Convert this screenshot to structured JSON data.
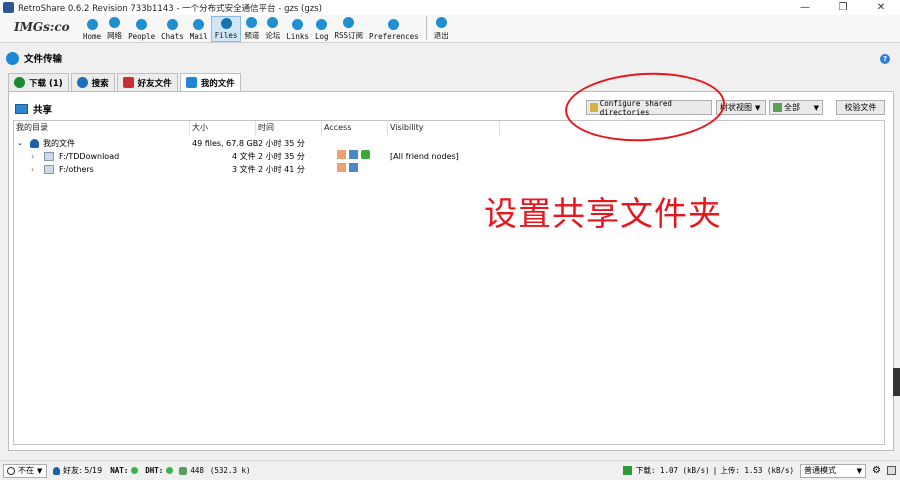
{
  "window": {
    "title": "RetroShare 0.6.2 Revision 733b1143 - 一个分布式安全通信平台 - gzs (gzs)",
    "controls": [
      "—",
      "❐",
      "✕"
    ]
  },
  "toolbar": {
    "logo": "IMGs:co",
    "items": [
      {
        "label": "Home",
        "icon": "home-icon"
      },
      {
        "label": "网络",
        "icon": "network-icon"
      },
      {
        "label": "People",
        "icon": "people-icon"
      },
      {
        "label": "Chats",
        "icon": "chats-icon"
      },
      {
        "label": "Mail",
        "icon": "mail-icon"
      },
      {
        "label": "Files",
        "icon": "files-icon",
        "active": true
      },
      {
        "label": "频道",
        "icon": "channels-icon"
      },
      {
        "label": "论坛",
        "icon": "forums-icon"
      },
      {
        "label": "Links",
        "icon": "links-icon"
      },
      {
        "label": "Log",
        "icon": "log-icon"
      },
      {
        "label": "RSS订阅",
        "icon": "rss-icon"
      },
      {
        "label": "Preferences",
        "icon": "gear-icon"
      }
    ],
    "exit_label": "退出"
  },
  "section": {
    "title": "文件传输",
    "help": "?"
  },
  "tabs": [
    {
      "label": "下载 (1)",
      "icon": "download-icon",
      "color": "#1b8a2e"
    },
    {
      "label": "搜索",
      "icon": "search-icon",
      "color": "#1e6fc2"
    },
    {
      "label": "好友文件",
      "icon": "friends-files-icon",
      "color": "#c83030"
    },
    {
      "label": "我的文件",
      "icon": "my-files-icon",
      "color": "#1e88d6",
      "active": true
    }
  ],
  "share": {
    "title": "共享",
    "configure_label": "Configure shared directories",
    "view_label": "树状视图",
    "filter_label": "全部",
    "check_label": "校验文件"
  },
  "columns": [
    "我的目录",
    "大小",
    "时间",
    "Access",
    "Visibility"
  ],
  "rows": [
    {
      "name": "我的文件",
      "size": "49 files, 67.8 GB",
      "time": "2 小时 35 分",
      "visibility": ""
    },
    {
      "name": "F:/TDDownload",
      "size": "4 文件",
      "time": "2 小时 35 分",
      "visibility": "[All friend nodes]"
    },
    {
      "name": "F:/others",
      "size": "3 文件",
      "time": "2 小时 41 分",
      "visibility": ""
    }
  ],
  "annotation": "设置共享文件夹",
  "status": {
    "state": "不在",
    "friends": "好友: 5/19",
    "nat": "NAT:",
    "dht": "DHT:",
    "peers": "448",
    "peers_size": "(532.3 k)",
    "download": "下载: 1.07 (kB/s)",
    "upload": "上传: 1.53 (kB/s)",
    "mode": "普通模式"
  },
  "colors": {
    "accent": "#1e88d6",
    "annotation": "#e8161c",
    "ok": "#39b54a"
  }
}
